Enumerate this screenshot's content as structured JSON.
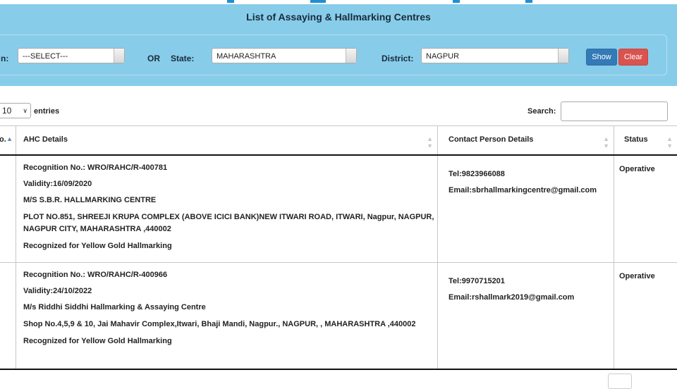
{
  "panel": {
    "title": "List of Assaying & Hallmarking Centres",
    "region_label": "n:",
    "region_value": "---SELECT---",
    "or_label": "OR",
    "state_label": "State:",
    "state_value": "MAHARASHTRA",
    "district_label": "District:",
    "district_value": "NAGPUR",
    "show_label": "Show",
    "clear_label": "Clear"
  },
  "controls": {
    "length_value": "10",
    "entries_label": "entries",
    "search_label": "Search:",
    "search_value": ""
  },
  "table": {
    "headers": {
      "sno": "o.",
      "ahc": "AHC Details",
      "contact": "Contact Person Details",
      "status": "Status"
    },
    "rows": [
      {
        "recognition": "Recognition No.: WRO/RAHC/R-400781",
        "validity": "Validity:16/09/2020",
        "name": "M/S S.B.R. HALLMARKING CENTRE",
        "address": "PLOT NO.851, SHREEJI KRUPA COMPLEX (ABOVE ICICI BANK)NEW ITWARI ROAD, ITWARI, Nagpur, NAGPUR, NAGPUR CITY, MAHARASHTRA ,440002",
        "recognized": "Recognized for Yellow Gold Hallmarking",
        "tel": "Tel:9823966088",
        "email": "Email:sbrhallmarkingcentre@gmail.com",
        "status": "Operative"
      },
      {
        "recognition": "Recognition No.: WRO/RAHC/R-400966",
        "validity": "Validity:24/10/2022",
        "name": "M/s Riddhi Siddhi Hallmarking & Assaying Centre",
        "address": "Shop No.4,5,9 & 10, Jai Mahavir Complex,Itwari, Bhaji Mandi, Nagpur., NAGPUR, , MAHARASHTRA ,440002",
        "recognized": "Recognized for Yellow Gold Hallmarking",
        "tel": "Tel:9970715201",
        "email": "Email:rshallmark2019@gmail.com",
        "status": "Operative"
      }
    ]
  },
  "colors": {
    "panel_bg": "#87cdea",
    "show_button": "#337ab7",
    "clear_button": "#d9534f"
  }
}
